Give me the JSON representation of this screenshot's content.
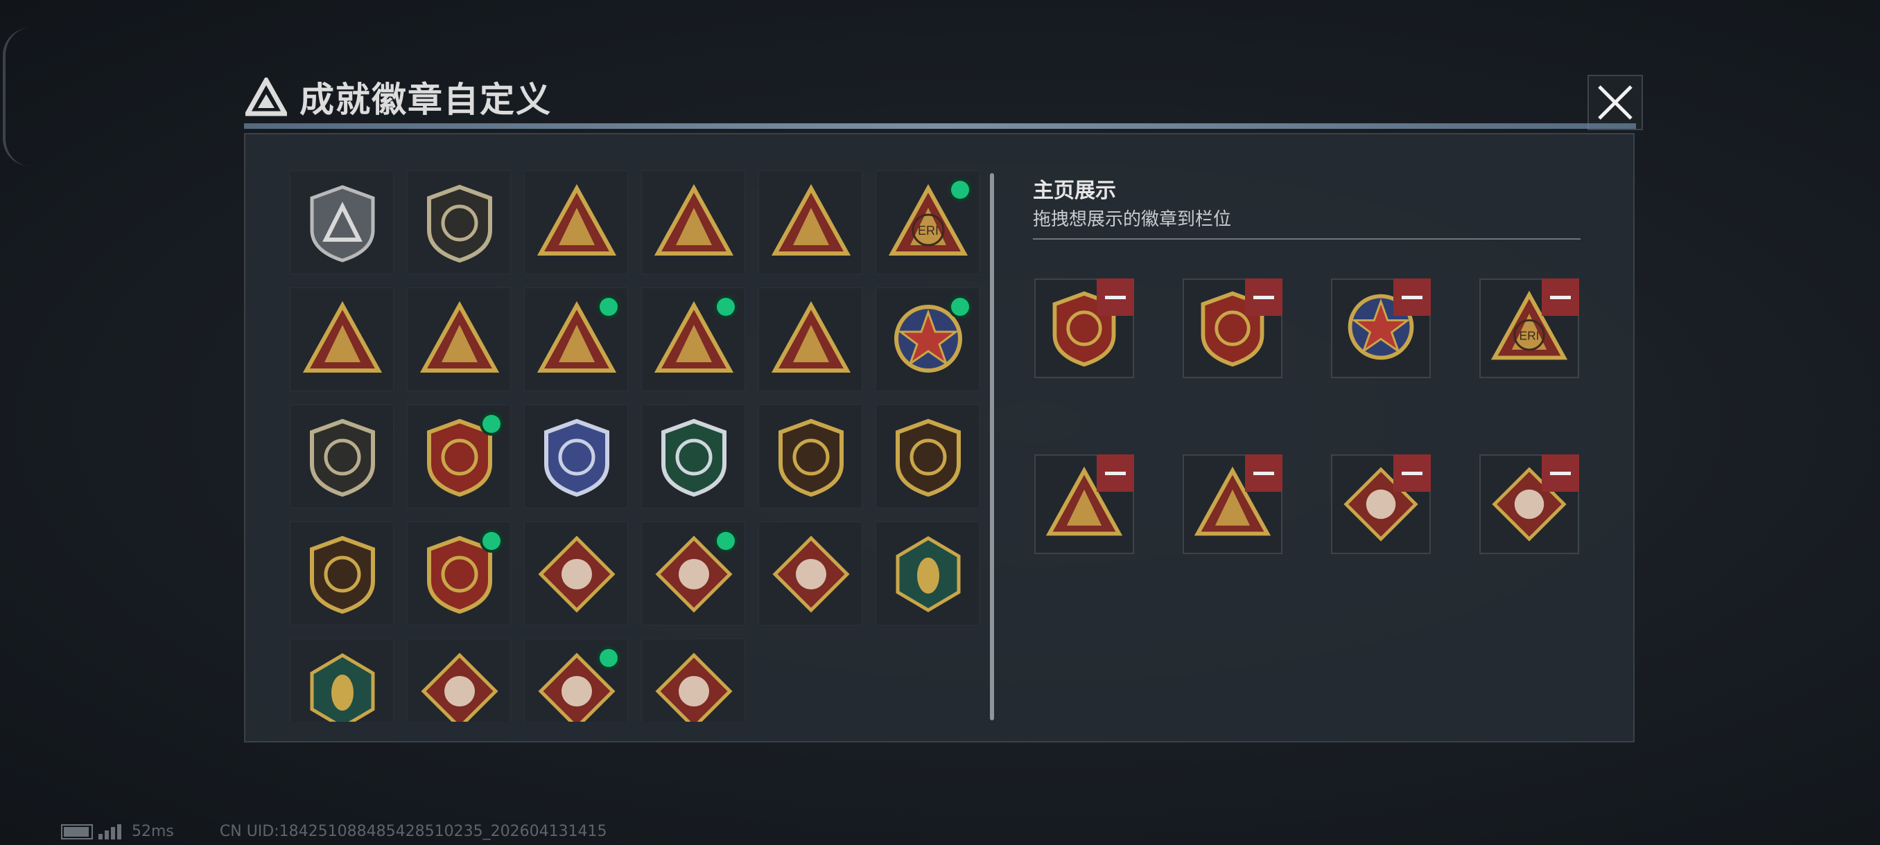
{
  "header": {
    "title": "成就徽章自定义",
    "close_icon": "close-icon"
  },
  "showcase": {
    "title": "主页展示",
    "subtitle": "拖拽想展示的徽章到栏位"
  },
  "footer": {
    "ping": "52ms",
    "uid": "CN UID:1842510884854285102​35_202604131415"
  },
  "colors": {
    "accent_gold": "#c9a64a",
    "equipped_dot": "#18c27a",
    "remove_red": "#8e2d2f"
  },
  "badges": [
    {
      "icon": "gray-shield-triangle-badge",
      "equipped": false
    },
    {
      "icon": "helicopter-shield-badge",
      "equipped": false
    },
    {
      "icon": "tower-triangle-badge",
      "equipped": false
    },
    {
      "icon": "vehicle-triangle-badge",
      "equipped": false
    },
    {
      "icon": "soldier-triangle-badge",
      "equipped": false
    },
    {
      "icon": "globe-eri-triangle-badge",
      "equipped": true
    },
    {
      "icon": "hand-triangle-badge",
      "equipped": false
    },
    {
      "icon": "number-one-triangle-badge",
      "equipped": false
    },
    {
      "icon": "usb-triangle-badge",
      "equipped": true
    },
    {
      "icon": "kneeling-soldier-triangle-badge",
      "equipped": true
    },
    {
      "icon": "squad-triangle-badge",
      "equipped": false
    },
    {
      "icon": "star-medal-badge",
      "equipped": true
    },
    {
      "icon": "chevron-shield-badge",
      "equipped": false
    },
    {
      "icon": "red-gold-shield-badge",
      "equipped": true
    },
    {
      "icon": "diamond-shield-badge",
      "equipped": false
    },
    {
      "icon": "green-rifle-shield-badge",
      "equipped": false
    },
    {
      "icon": "rifle-shield-badge",
      "equipped": false
    },
    {
      "icon": "rifle-shield-badge-2",
      "equipped": false
    },
    {
      "icon": "sniper-shield-badge",
      "equipped": false
    },
    {
      "icon": "crossed-rifles-shield-badge",
      "equipped": true
    },
    {
      "icon": "wolf-diamond-badge",
      "equipped": false
    },
    {
      "icon": "wolf-diamond-badge-2",
      "equipped": true
    },
    {
      "icon": "fist-diamond-badge",
      "equipped": false
    },
    {
      "icon": "wasp-hexagon-badge",
      "equipped": false
    },
    {
      "icon": "green-hexagon-badge",
      "equipped": false
    },
    {
      "icon": "dragon-diamond-badge",
      "equipped": false
    },
    {
      "icon": "dragon-diamond-badge-2",
      "equipped": true
    },
    {
      "icon": "runner-diamond-badge",
      "equipped": false
    }
  ],
  "slots": [
    {
      "icon": "red-gold-shield-badge"
    },
    {
      "icon": "crossed-rifles-shield-badge"
    },
    {
      "icon": "star-medal-badge"
    },
    {
      "icon": "globe-eri-triangle-badge"
    },
    {
      "icon": "usb-triangle-badge"
    },
    {
      "icon": "kneeling-soldier-triangle-badge"
    },
    {
      "icon": "wolf-diamond-badge-2"
    },
    {
      "icon": "dragon-diamond-badge-2"
    }
  ]
}
